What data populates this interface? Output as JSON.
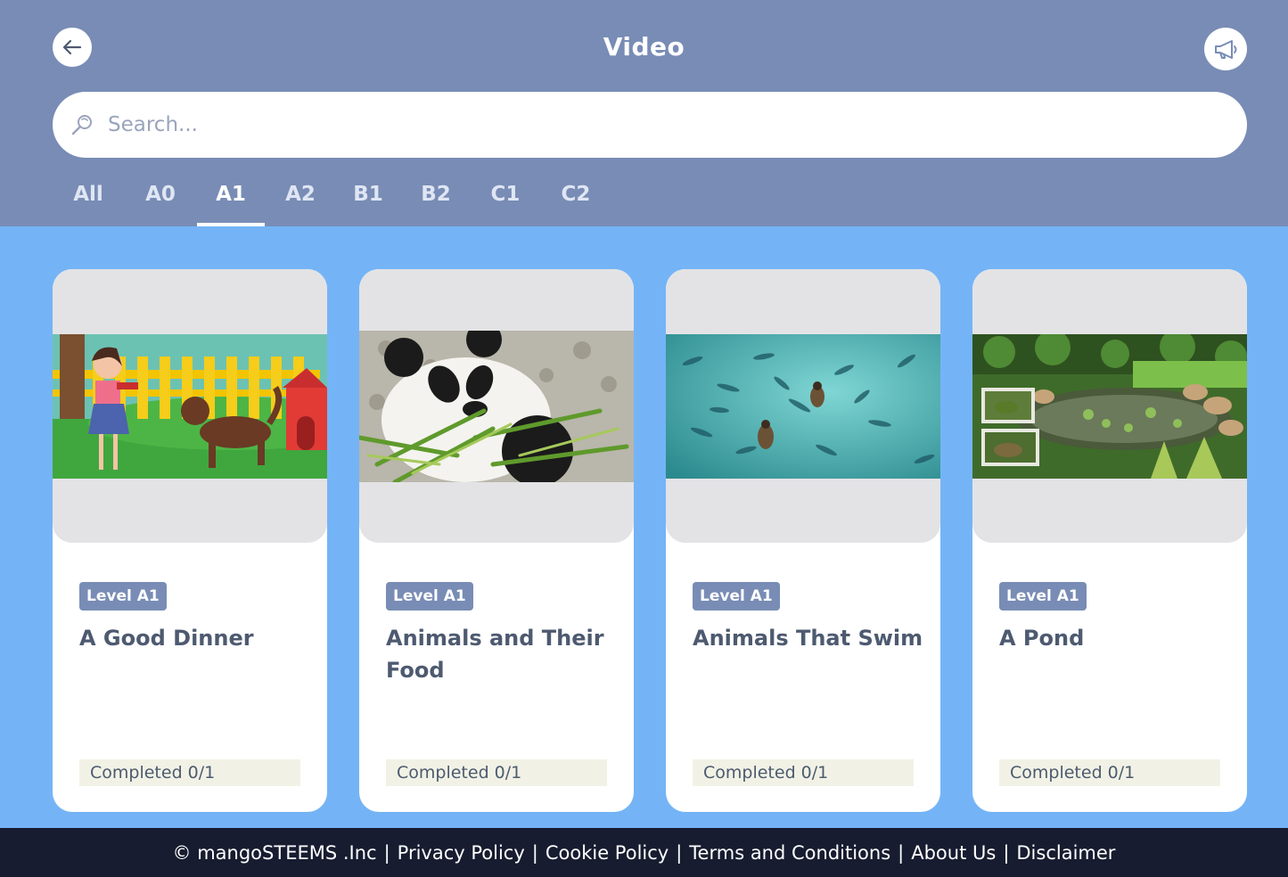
{
  "header": {
    "title": "Video",
    "back_icon": "arrow-left-icon",
    "announce_icon": "megaphone-icon",
    "colors": {
      "header_bg": "#788cb5",
      "body_bg": "#74b4f6",
      "footer_bg": "#171c30"
    }
  },
  "search": {
    "placeholder": "Search...",
    "value": "",
    "icon": "search-icon"
  },
  "tabs": {
    "selected": "A1",
    "items": [
      {
        "label": "All"
      },
      {
        "label": "A0"
      },
      {
        "label": "A1"
      },
      {
        "label": "A2"
      },
      {
        "label": "B1"
      },
      {
        "label": "B2"
      },
      {
        "label": "C1"
      },
      {
        "label": "C2"
      }
    ]
  },
  "cards": [
    {
      "level": "Level A1",
      "title": "A Good Dinner",
      "progress_text": "Completed 0/1",
      "completed": 0,
      "total": 1
    },
    {
      "level": "Level A1",
      "title": "Animals and Their Food",
      "progress_text": "Completed 0/1",
      "completed": 0,
      "total": 1
    },
    {
      "level": "Level A1",
      "title": "Animals That Swim",
      "progress_text": "Completed 0/1",
      "completed": 0,
      "total": 1
    },
    {
      "level": "Level A1",
      "title": "A Pond",
      "progress_text": "Completed 0/1",
      "completed": 0,
      "total": 1
    }
  ],
  "footer": {
    "copyright": "© mangoSTEEMS .Inc",
    "links": [
      {
        "label": "Privacy Policy"
      },
      {
        "label": "Cookie Policy"
      },
      {
        "label": "Terms and Conditions"
      },
      {
        "label": "About Us"
      },
      {
        "label": "Disclaimer"
      }
    ],
    "separator": "|"
  }
}
